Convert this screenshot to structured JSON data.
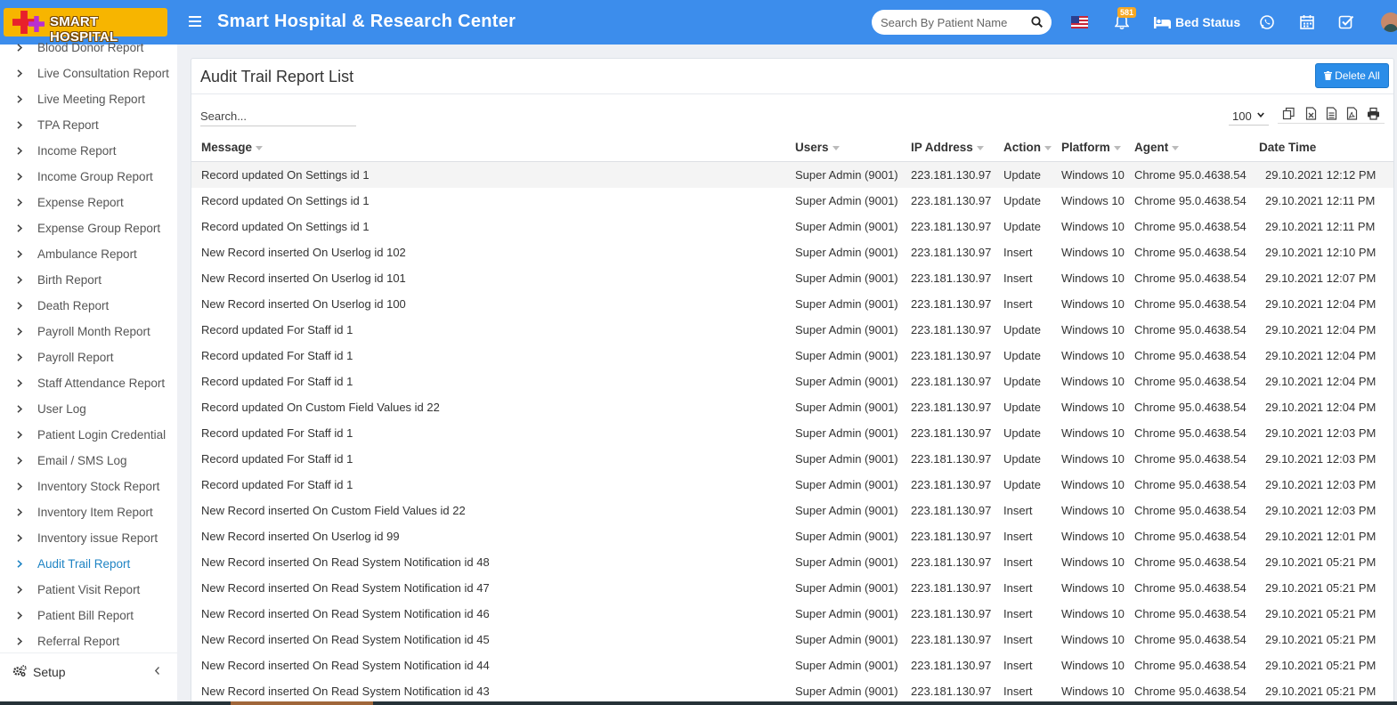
{
  "header": {
    "logo_text": "SMART HOSPITAL",
    "title": "Smart Hospital & Research Center",
    "search_placeholder": "Search By Patient Name",
    "notification_count": "581",
    "bed_status_label": "Bed Status",
    "accent_color": "#3c8dec"
  },
  "sidebar": {
    "items": [
      {
        "label": "Blood Donor Report"
      },
      {
        "label": "Live Consultation Report"
      },
      {
        "label": "Live Meeting Report"
      },
      {
        "label": "TPA Report"
      },
      {
        "label": "Income Report"
      },
      {
        "label": "Income Group Report"
      },
      {
        "label": "Expense Report"
      },
      {
        "label": "Expense Group Report"
      },
      {
        "label": "Ambulance Report"
      },
      {
        "label": "Birth Report"
      },
      {
        "label": "Death Report"
      },
      {
        "label": "Payroll Month Report"
      },
      {
        "label": "Payroll Report"
      },
      {
        "label": "Staff Attendance Report"
      },
      {
        "label": "User Log"
      },
      {
        "label": "Patient Login Credential"
      },
      {
        "label": "Email / SMS Log"
      },
      {
        "label": "Inventory Stock Report"
      },
      {
        "label": "Inventory Item Report"
      },
      {
        "label": "Inventory issue Report"
      },
      {
        "label": "Audit Trail Report",
        "active": true
      },
      {
        "label": "Patient Visit Report"
      },
      {
        "label": "Patient Bill Report"
      },
      {
        "label": "Referral Report"
      }
    ],
    "setup_label": "Setup"
  },
  "main": {
    "title": "Audit Trail Report List",
    "delete_all_label": "Delete All",
    "search_placeholder": "Search...",
    "page_size": "100",
    "columns": [
      "Message",
      "Users",
      "IP Address",
      "Action",
      "Platform",
      "Agent",
      "Date Time"
    ],
    "rows": [
      [
        "Record updated On Settings id 1",
        "Super Admin (9001)",
        "223.181.130.97",
        "Update",
        "Windows 10",
        "Chrome 95.0.4638.54",
        "29.10.2021 12:12 PM"
      ],
      [
        "Record updated On Settings id 1",
        "Super Admin (9001)",
        "223.181.130.97",
        "Update",
        "Windows 10",
        "Chrome 95.0.4638.54",
        "29.10.2021 12:11 PM"
      ],
      [
        "Record updated On Settings id 1",
        "Super Admin (9001)",
        "223.181.130.97",
        "Update",
        "Windows 10",
        "Chrome 95.0.4638.54",
        "29.10.2021 12:11 PM"
      ],
      [
        "New Record inserted On Userlog id 102",
        "Super Admin (9001)",
        "223.181.130.97",
        "Insert",
        "Windows 10",
        "Chrome 95.0.4638.54",
        "29.10.2021 12:10 PM"
      ],
      [
        "New Record inserted On Userlog id 101",
        "Super Admin (9001)",
        "223.181.130.97",
        "Insert",
        "Windows 10",
        "Chrome 95.0.4638.54",
        "29.10.2021 12:07 PM"
      ],
      [
        "New Record inserted On Userlog id 100",
        "Super Admin (9001)",
        "223.181.130.97",
        "Insert",
        "Windows 10",
        "Chrome 95.0.4638.54",
        "29.10.2021 12:04 PM"
      ],
      [
        "Record updated For Staff id 1",
        "Super Admin (9001)",
        "223.181.130.97",
        "Update",
        "Windows 10",
        "Chrome 95.0.4638.54",
        "29.10.2021 12:04 PM"
      ],
      [
        "Record updated For Staff id 1",
        "Super Admin (9001)",
        "223.181.130.97",
        "Update",
        "Windows 10",
        "Chrome 95.0.4638.54",
        "29.10.2021 12:04 PM"
      ],
      [
        "Record updated For Staff id 1",
        "Super Admin (9001)",
        "223.181.130.97",
        "Update",
        "Windows 10",
        "Chrome 95.0.4638.54",
        "29.10.2021 12:04 PM"
      ],
      [
        "Record updated On Custom Field Values id 22",
        "Super Admin (9001)",
        "223.181.130.97",
        "Update",
        "Windows 10",
        "Chrome 95.0.4638.54",
        "29.10.2021 12:04 PM"
      ],
      [
        "Record updated For Staff id 1",
        "Super Admin (9001)",
        "223.181.130.97",
        "Update",
        "Windows 10",
        "Chrome 95.0.4638.54",
        "29.10.2021 12:03 PM"
      ],
      [
        "Record updated For Staff id 1",
        "Super Admin (9001)",
        "223.181.130.97",
        "Update",
        "Windows 10",
        "Chrome 95.0.4638.54",
        "29.10.2021 12:03 PM"
      ],
      [
        "Record updated For Staff id 1",
        "Super Admin (9001)",
        "223.181.130.97",
        "Update",
        "Windows 10",
        "Chrome 95.0.4638.54",
        "29.10.2021 12:03 PM"
      ],
      [
        "New Record inserted On Custom Field Values id 22",
        "Super Admin (9001)",
        "223.181.130.97",
        "Insert",
        "Windows 10",
        "Chrome 95.0.4638.54",
        "29.10.2021 12:03 PM"
      ],
      [
        "New Record inserted On Userlog id 99",
        "Super Admin (9001)",
        "223.181.130.97",
        "Insert",
        "Windows 10",
        "Chrome 95.0.4638.54",
        "29.10.2021 12:01 PM"
      ],
      [
        "New Record inserted On Read System Notification id 48",
        "Super Admin (9001)",
        "223.181.130.97",
        "Insert",
        "Windows 10",
        "Chrome 95.0.4638.54",
        "29.10.2021 05:21 PM"
      ],
      [
        "New Record inserted On Read System Notification id 47",
        "Super Admin (9001)",
        "223.181.130.97",
        "Insert",
        "Windows 10",
        "Chrome 95.0.4638.54",
        "29.10.2021 05:21 PM"
      ],
      [
        "New Record inserted On Read System Notification id 46",
        "Super Admin (9001)",
        "223.181.130.97",
        "Insert",
        "Windows 10",
        "Chrome 95.0.4638.54",
        "29.10.2021 05:21 PM"
      ],
      [
        "New Record inserted On Read System Notification id 45",
        "Super Admin (9001)",
        "223.181.130.97",
        "Insert",
        "Windows 10",
        "Chrome 95.0.4638.54",
        "29.10.2021 05:21 PM"
      ],
      [
        "New Record inserted On Read System Notification id 44",
        "Super Admin (9001)",
        "223.181.130.97",
        "Insert",
        "Windows 10",
        "Chrome 95.0.4638.54",
        "29.10.2021 05:21 PM"
      ],
      [
        "New Record inserted On Read System Notification id 43",
        "Super Admin (9001)",
        "223.181.130.97",
        "Insert",
        "Windows 10",
        "Chrome 95.0.4638.54",
        "29.10.2021 05:21 PM"
      ]
    ]
  },
  "icons": [
    "search-icon",
    "flag-us-icon",
    "bell-icon",
    "bed-icon",
    "whatsapp-icon",
    "calendar-icon",
    "task-check-icon",
    "trash-icon",
    "copy-icon",
    "excel-icon",
    "csv-icon",
    "pdf-icon",
    "print-icon",
    "gear-icon",
    "chevron-right-icon",
    "chevron-left-icon"
  ]
}
